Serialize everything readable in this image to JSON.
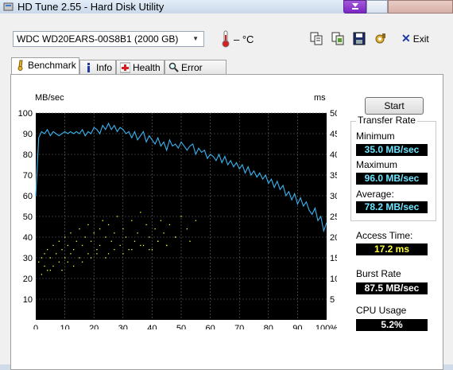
{
  "window": {
    "title": "HD Tune 2.55 - Hard Disk Utility"
  },
  "toolbar": {
    "drive": "WDC WD20EARS-00S8B1 (2000 GB)",
    "temperature": "– °C",
    "exit_label": "Exit"
  },
  "tabs": [
    "Benchmark",
    "Info",
    "Health",
    "Error Scan"
  ],
  "benchmark": {
    "start_label": "Start",
    "transfer_rate_title": "Transfer Rate",
    "minimum_label": "Minimum",
    "minimum_value": "35.0 MB/sec",
    "maximum_label": "Maximum",
    "maximum_value": "96.0 MB/sec",
    "average_label": "Average:",
    "average_value": "78.2 MB/sec",
    "access_time_label": "Access Time:",
    "access_time_value": "17.2 ms",
    "burst_rate_label": "Burst Rate",
    "burst_rate_value": "87.5 MB/sec",
    "cpu_usage_label": "CPU Usage",
    "cpu_usage_value": "5.2%"
  },
  "chart_data": {
    "type": "line",
    "left_unit": "MB/sec",
    "right_unit": "ms",
    "left_ticks": [
      "100",
      "90",
      "80",
      "70",
      "60",
      "50",
      "40",
      "30",
      "20",
      "10"
    ],
    "right_ticks": [
      "50",
      "45",
      "40",
      "35",
      "30",
      "25",
      "20",
      "15",
      "10",
      "5"
    ],
    "x_ticks": [
      "0",
      "10",
      "20",
      "30",
      "40",
      "50",
      "60",
      "70",
      "80",
      "90",
      "100%"
    ],
    "xlim": [
      0,
      100
    ],
    "ylim_left": [
      0,
      100
    ],
    "ylim_right": [
      0,
      50
    ],
    "grid": true,
    "colors": {
      "transfer": "#3ab4f0",
      "access": "#ffff40",
      "background": "#000000",
      "grid": "#6a6a6a"
    },
    "series": [
      {
        "type": "line",
        "x": [
          0,
          1,
          2,
          3,
          4,
          5,
          6,
          7,
          8,
          9,
          10,
          11,
          12,
          13,
          14,
          15,
          16,
          17,
          18,
          19,
          20,
          21,
          22,
          23,
          24,
          25,
          26,
          27,
          28,
          29,
          30,
          31,
          32,
          33,
          34,
          35,
          36,
          37,
          38,
          39,
          40,
          41,
          42,
          43,
          44,
          45,
          46,
          47,
          48,
          49,
          50,
          51,
          52,
          53,
          54,
          55,
          56,
          57,
          58,
          59,
          60,
          61,
          62,
          63,
          64,
          65,
          66,
          67,
          68,
          69,
          70,
          71,
          72,
          73,
          74,
          75,
          76,
          77,
          78,
          79,
          80,
          81,
          82,
          83,
          84,
          85,
          86,
          87,
          88,
          89,
          90,
          91,
          92,
          93,
          94,
          95,
          96,
          97,
          98,
          99,
          100
        ],
        "y": [
          60,
          88,
          91,
          90,
          92,
          89,
          91,
          90,
          89,
          90,
          91,
          90,
          91,
          90,
          91,
          90,
          92,
          89,
          91,
          90,
          93,
          92,
          90,
          94,
          92,
          95,
          92,
          94,
          91,
          93,
          92,
          90,
          91,
          88,
          91,
          87,
          89,
          91,
          86,
          89,
          87,
          85,
          88,
          84,
          86,
          82,
          87,
          84,
          85,
          83,
          86,
          84,
          82,
          84,
          85,
          80,
          83,
          81,
          82,
          78,
          80,
          79,
          77,
          80,
          76,
          79,
          75,
          77,
          74,
          76,
          73,
          75,
          71,
          74,
          70,
          72,
          69,
          71,
          68,
          70,
          66,
          68,
          64,
          67,
          63,
          65,
          60,
          62,
          58,
          61,
          56,
          59,
          55,
          57,
          53,
          51,
          54,
          48,
          50,
          43,
          47
        ]
      },
      {
        "type": "scatter",
        "name": "access",
        "unit": "ms",
        "x": [
          1,
          2,
          3,
          3,
          4,
          5,
          5,
          6,
          7,
          8,
          8,
          9,
          10,
          10,
          11,
          12,
          12,
          13,
          14,
          15,
          15,
          16,
          17,
          18,
          18,
          19,
          20,
          21,
          22,
          22,
          23,
          24,
          25,
          25,
          26,
          27,
          28,
          29,
          30,
          31,
          32,
          33,
          34,
          35,
          36,
          37,
          38,
          39,
          40,
          41,
          42,
          43,
          44,
          45,
          46,
          48,
          50,
          52,
          53,
          55,
          2,
          4,
          6,
          9,
          11,
          13,
          16,
          19,
          21,
          24,
          27,
          30,
          33,
          36,
          39,
          42,
          45,
          48
        ],
        "y": [
          14,
          15,
          13,
          16,
          17,
          12,
          15,
          18,
          16,
          14,
          19,
          17,
          15,
          20,
          18,
          16,
          21,
          17,
          19,
          15,
          22,
          18,
          20,
          16,
          23,
          19,
          21,
          17,
          22,
          18,
          24,
          20,
          16,
          23,
          19,
          21,
          25,
          18,
          22,
          20,
          17,
          24,
          19,
          21,
          26,
          18,
          23,
          20,
          17,
          22,
          19,
          24,
          21,
          18,
          23,
          20,
          25,
          22,
          19,
          24,
          11,
          12,
          13,
          12,
          14,
          13,
          14,
          15,
          16,
          15,
          17,
          16,
          17,
          18,
          17,
          19,
          18,
          20
        ]
      }
    ]
  }
}
